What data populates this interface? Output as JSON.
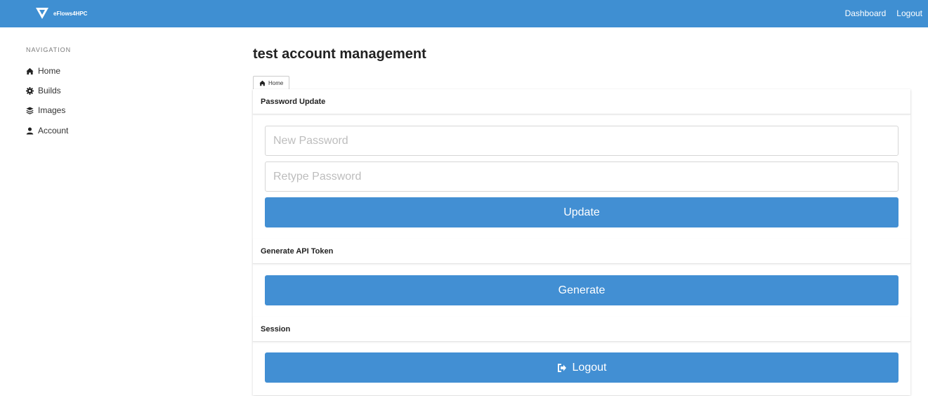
{
  "brand": {
    "name": "eFlows4HPC",
    "logo_icon": "eflows-logo-icon"
  },
  "topnav": {
    "dashboard": "Dashboard",
    "logout": "Logout"
  },
  "sidebar": {
    "heading": "NAVIGATION",
    "items": [
      {
        "label": "Home",
        "icon": "home-icon"
      },
      {
        "label": "Builds",
        "icon": "gear-icon"
      },
      {
        "label": "Images",
        "icon": "layers-icon"
      },
      {
        "label": "Account",
        "icon": "user-icon"
      }
    ]
  },
  "page": {
    "title": "test account management"
  },
  "breadcrumb": {
    "home": "Home"
  },
  "password_section": {
    "title": "Password Update",
    "new_password_placeholder": "New Password",
    "retype_password_placeholder": "Retype Password",
    "update_label": "Update"
  },
  "token_section": {
    "title": "Generate API Token",
    "generate_label": "Generate"
  },
  "session_section": {
    "title": "Session",
    "logout_label": "Logout"
  },
  "colors": {
    "primary": "#428fd3",
    "topbar": "#3f8fd2"
  }
}
